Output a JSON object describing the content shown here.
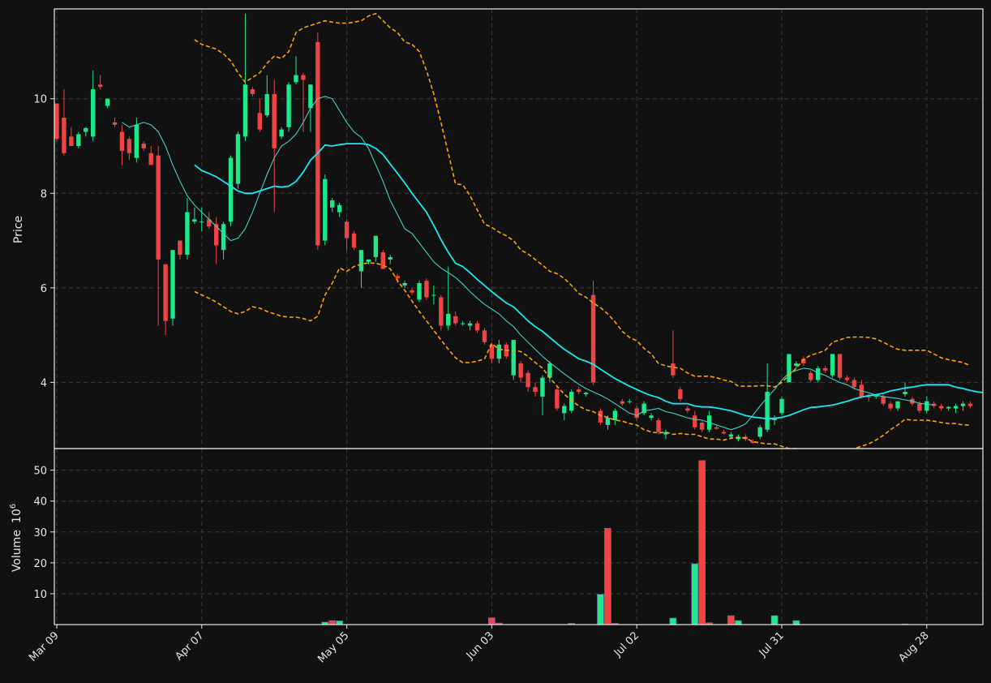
{
  "chart_data": {
    "type": "candlestick",
    "colors": {
      "up": "#1de98b",
      "down": "#ef4444",
      "ma_slow": "#19e8f4",
      "ma_fast": "#3fd3c6",
      "bands": "#ffa500",
      "background": "#111111",
      "grid": "#3c3c3c",
      "text": "#e6e6e6"
    },
    "price_panel": {
      "ylabel": "Price",
      "yticks": [
        4,
        6,
        8,
        10
      ],
      "ylim": [
        2.6,
        11.9
      ],
      "grid": true
    },
    "volume_panel": {
      "ylabel": "Volume",
      "scale_label": "10",
      "scale_exp": "6",
      "yticks": [
        10,
        20,
        30,
        40,
        50
      ],
      "ylim": [
        0,
        57
      ],
      "grid": true
    },
    "x_tick_labels": [
      "Mar 09",
      "Apr 07",
      "May 05",
      "Jun 03",
      "Jul 02",
      "Jul 31",
      "Aug 28"
    ],
    "x_tick_index": [
      0,
      20,
      40,
      60,
      80,
      100,
      120
    ],
    "candles": [
      [
        9.9,
        9.9,
        9.1,
        9.15
      ],
      [
        9.6,
        10.2,
        8.8,
        8.85
      ],
      [
        9.2,
        9.4,
        9.0,
        9.0
      ],
      [
        9.0,
        9.3,
        8.95,
        9.25
      ],
      [
        9.3,
        9.4,
        9.2,
        9.38
      ],
      [
        9.2,
        10.6,
        9.1,
        10.2
      ],
      [
        10.3,
        10.5,
        10.2,
        10.25
      ],
      [
        9.85,
        10.0,
        9.8,
        10.0
      ],
      [
        9.5,
        9.6,
        9.4,
        9.45
      ],
      [
        9.3,
        9.45,
        8.6,
        8.9
      ],
      [
        9.15,
        9.2,
        8.7,
        8.85
      ],
      [
        8.75,
        9.6,
        8.65,
        9.45
      ],
      [
        9.05,
        9.1,
        8.9,
        8.95
      ],
      [
        8.85,
        9.0,
        8.6,
        8.6
      ],
      [
        8.8,
        9.0,
        5.2,
        6.6
      ],
      [
        6.5,
        6.5,
        5.0,
        5.3
      ],
      [
        5.35,
        6.8,
        5.2,
        6.8
      ],
      [
        7.0,
        7.0,
        6.6,
        6.7
      ],
      [
        6.7,
        7.9,
        6.6,
        7.6
      ],
      [
        7.4,
        7.7,
        7.35,
        7.45
      ],
      [
        7.4,
        7.7,
        7.2,
        7.4
      ],
      [
        7.45,
        7.6,
        7.25,
        7.3
      ],
      [
        7.35,
        7.5,
        6.5,
        6.9
      ],
      [
        6.8,
        7.4,
        6.6,
        7.35
      ],
      [
        7.4,
        8.8,
        7.3,
        8.75
      ],
      [
        8.2,
        9.3,
        8.1,
        9.25
      ],
      [
        9.2,
        11.8,
        9.1,
        10.3
      ],
      [
        10.2,
        10.25,
        10.05,
        10.1
      ],
      [
        9.7,
        10.0,
        9.3,
        9.35
      ],
      [
        9.65,
        10.5,
        9.6,
        10.1
      ],
      [
        10.1,
        10.4,
        7.6,
        8.95
      ],
      [
        9.2,
        9.4,
        9.15,
        9.35
      ],
      [
        9.4,
        10.35,
        9.3,
        10.3
      ],
      [
        10.35,
        10.9,
        10.3,
        10.5
      ],
      [
        10.5,
        10.55,
        9.3,
        10.4
      ],
      [
        9.8,
        10.3,
        9.3,
        10.3
      ],
      [
        11.2,
        11.4,
        6.8,
        6.9
      ],
      [
        7.0,
        8.4,
        6.9,
        8.3
      ],
      [
        7.7,
        7.9,
        7.6,
        7.85
      ],
      [
        7.6,
        7.8,
        7.5,
        7.75
      ],
      [
        7.4,
        7.45,
        6.8,
        7.05
      ],
      [
        7.15,
        7.2,
        6.8,
        6.85
      ],
      [
        6.35,
        6.8,
        6.0,
        6.8
      ],
      [
        6.55,
        6.6,
        6.5,
        6.6
      ],
      [
        6.65,
        7.1,
        6.55,
        7.1
      ],
      [
        6.75,
        6.8,
        6.4,
        6.4
      ],
      [
        6.6,
        6.7,
        6.5,
        6.65
      ],
      [
        6.25,
        6.3,
        6.1,
        6.2
      ],
      [
        6.05,
        6.15,
        6.0,
        6.1
      ],
      [
        5.95,
        6.0,
        5.85,
        5.9
      ],
      [
        5.75,
        6.15,
        5.7,
        6.1
      ],
      [
        6.15,
        6.2,
        5.75,
        5.8
      ],
      [
        5.85,
        6.05,
        5.65,
        5.85
      ],
      [
        5.8,
        5.85,
        5.1,
        5.2
      ],
      [
        5.2,
        6.45,
        5.1,
        5.45
      ],
      [
        5.4,
        5.5,
        5.2,
        5.25
      ],
      [
        5.25,
        5.3,
        5.2,
        5.25
      ],
      [
        5.2,
        5.3,
        5.1,
        5.25
      ],
      [
        5.25,
        5.3,
        5.05,
        5.1
      ],
      [
        5.1,
        5.15,
        4.8,
        4.85
      ],
      [
        4.8,
        4.8,
        4.4,
        4.5
      ],
      [
        4.5,
        4.9,
        4.4,
        4.8
      ],
      [
        4.8,
        4.85,
        4.5,
        4.55
      ],
      [
        4.15,
        4.9,
        4.05,
        4.9
      ],
      [
        4.4,
        4.45,
        4.0,
        4.1
      ],
      [
        4.2,
        4.25,
        3.8,
        3.9
      ],
      [
        3.9,
        4.0,
        3.7,
        3.8
      ],
      [
        3.7,
        4.15,
        3.3,
        4.1
      ],
      [
        4.1,
        4.45,
        4.0,
        4.4
      ],
      [
        3.85,
        3.9,
        3.4,
        3.45
      ],
      [
        3.35,
        3.55,
        3.2,
        3.5
      ],
      [
        3.4,
        3.85,
        3.35,
        3.8
      ],
      [
        3.85,
        3.9,
        3.75,
        3.8
      ],
      [
        3.75,
        3.8,
        3.7,
        3.78
      ],
      [
        5.85,
        6.15,
        3.95,
        4.0
      ],
      [
        3.4,
        3.45,
        3.1,
        3.15
      ],
      [
        3.1,
        3.3,
        3.0,
        3.25
      ],
      [
        3.2,
        3.45,
        3.1,
        3.4
      ],
      [
        3.6,
        3.65,
        3.5,
        3.55
      ],
      [
        3.6,
        3.65,
        3.55,
        3.6
      ],
      [
        3.45,
        3.5,
        3.2,
        3.25
      ],
      [
        3.35,
        3.6,
        3.3,
        3.55
      ],
      [
        3.25,
        3.35,
        3.2,
        3.3
      ],
      [
        3.2,
        3.25,
        2.9,
        2.95
      ],
      [
        2.9,
        3.0,
        2.8,
        2.95
      ],
      [
        4.4,
        5.1,
        4.1,
        4.15
      ],
      [
        3.85,
        3.9,
        3.6,
        3.65
      ],
      [
        3.45,
        3.5,
        3.35,
        3.4
      ],
      [
        3.3,
        3.4,
        3.0,
        3.05
      ],
      [
        3.15,
        3.2,
        2.95,
        3.0
      ],
      [
        3.0,
        3.4,
        2.95,
        3.3
      ],
      [
        3.05,
        3.1,
        3.0,
        3.02
      ],
      [
        2.95,
        3.0,
        2.9,
        2.92
      ],
      [
        2.85,
        2.95,
        2.8,
        2.9
      ],
      [
        2.8,
        2.9,
        2.75,
        2.85
      ],
      [
        2.85,
        2.9,
        2.75,
        2.8
      ],
      [
        2.75,
        2.8,
        2.7,
        2.72
      ],
      [
        2.85,
        3.1,
        2.8,
        3.05
      ],
      [
        3.0,
        4.4,
        2.95,
        3.8
      ],
      [
        3.2,
        3.3,
        3.1,
        3.25
      ],
      [
        3.35,
        3.7,
        3.3,
        3.65
      ],
      [
        4.0,
        4.6,
        4.0,
        4.6
      ],
      [
        4.35,
        4.45,
        4.3,
        4.4
      ],
      [
        4.5,
        4.55,
        4.35,
        4.4
      ],
      [
        4.2,
        4.25,
        4.0,
        4.05
      ],
      [
        4.05,
        4.35,
        4.0,
        4.3
      ],
      [
        4.3,
        4.35,
        4.2,
        4.25
      ],
      [
        4.15,
        4.6,
        4.1,
        4.6
      ],
      [
        4.6,
        4.6,
        4.05,
        4.1
      ],
      [
        4.1,
        4.15,
        4.0,
        4.05
      ],
      [
        4.05,
        4.1,
        3.85,
        3.9
      ],
      [
        3.95,
        4.05,
        3.65,
        3.7
      ],
      [
        3.7,
        3.75,
        3.6,
        3.68
      ],
      [
        3.7,
        3.75,
        3.65,
        3.72
      ],
      [
        3.7,
        3.75,
        3.5,
        3.55
      ],
      [
        3.55,
        3.6,
        3.4,
        3.45
      ],
      [
        3.45,
        3.6,
        3.4,
        3.6
      ],
      [
        3.75,
        4.0,
        3.7,
        3.8
      ],
      [
        3.65,
        3.7,
        3.5,
        3.55
      ],
      [
        3.55,
        3.6,
        3.35,
        3.4
      ],
      [
        3.4,
        3.7,
        3.35,
        3.6
      ],
      [
        3.55,
        3.6,
        3.45,
        3.5
      ],
      [
        3.5,
        3.55,
        3.4,
        3.45
      ],
      [
        3.45,
        3.5,
        3.4,
        3.48
      ],
      [
        3.45,
        3.55,
        3.35,
        3.5
      ],
      [
        3.5,
        3.6,
        3.4,
        3.55
      ],
      [
        3.55,
        3.6,
        3.45,
        3.5
      ]
    ],
    "ma_slow": {
      "start": 19,
      "values": [
        8.6,
        8.48,
        8.42,
        8.35,
        8.25,
        8.15,
        8.05,
        8.0,
        8.0,
        8.05,
        8.1,
        8.15,
        8.13,
        8.15,
        8.25,
        8.45,
        8.7,
        8.85,
        9.02,
        9.0,
        9.03,
        9.05,
        9.05,
        9.05,
        9.03,
        8.95,
        8.82,
        8.62,
        8.42,
        8.22,
        8.0,
        7.8,
        7.6,
        7.32,
        7.02,
        6.75,
        6.52,
        6.45,
        6.32,
        6.18,
        6.05,
        5.92,
        5.8,
        5.68,
        5.6,
        5.45,
        5.3,
        5.18,
        5.08,
        4.95,
        4.82,
        4.7,
        4.6,
        4.5,
        4.45,
        4.38,
        4.28,
        4.18,
        4.08,
        4.0,
        3.92,
        3.85,
        3.78,
        3.72,
        3.68,
        3.6,
        3.55,
        3.55,
        3.55,
        3.5,
        3.48,
        3.48,
        3.46,
        3.43,
        3.4,
        3.35,
        3.3,
        3.27,
        3.25,
        3.23,
        3.24,
        3.26,
        3.3,
        3.36,
        3.42,
        3.47,
        3.48,
        3.5,
        3.52,
        3.56,
        3.6,
        3.65,
        3.69,
        3.72,
        3.74,
        3.77,
        3.82,
        3.85,
        3.88,
        3.9,
        3.93,
        3.95,
        3.95,
        3.95,
        3.95,
        3.9,
        3.87,
        3.83,
        3.8,
        3.78,
        3.75
      ]
    },
    "ma_fast": {
      "start": 9,
      "values": [
        9.5,
        9.4,
        9.45,
        9.5,
        9.45,
        9.3,
        9.0,
        8.6,
        8.25,
        7.95,
        7.75,
        7.6,
        7.45,
        7.3,
        7.15,
        7.0,
        7.05,
        7.25,
        7.6,
        8.0,
        8.4,
        8.75,
        9.0,
        9.1,
        9.25,
        9.5,
        9.8,
        10.0,
        10.05,
        10.0,
        9.75,
        9.5,
        9.3,
        9.18,
        8.95,
        8.6,
        8.25,
        7.85,
        7.55,
        7.25,
        7.15,
        6.95,
        6.75,
        6.55,
        6.42,
        6.32,
        6.22,
        6.08,
        5.92,
        5.78,
        5.65,
        5.55,
        5.45,
        5.3,
        5.18,
        5.0,
        4.85,
        4.7,
        4.55,
        4.42,
        4.3,
        4.18,
        4.07,
        3.96,
        3.87,
        3.8,
        3.73,
        3.65,
        3.55,
        3.45,
        3.35,
        3.3,
        3.4,
        3.42,
        3.45,
        3.38,
        3.35,
        3.3,
        3.25,
        3.22,
        3.2,
        3.15,
        3.1,
        3.05,
        3.0,
        3.05,
        3.12,
        3.3,
        3.5,
        3.68,
        3.85,
        4.05,
        4.2,
        4.25,
        4.3,
        4.28,
        4.2,
        4.15,
        4.07,
        4.0,
        3.95,
        3.87,
        3.82,
        3.78,
        3.73,
        3.7,
        3.68,
        3.66,
        3.63,
        3.6,
        3.56,
        3.54,
        3.52
      ]
    },
    "band_upper": {
      "start": 19,
      "values": [
        11.25,
        11.15,
        11.1,
        11.05,
        10.95,
        10.8,
        10.55,
        10.35,
        10.45,
        10.55,
        10.75,
        10.9,
        10.85,
        11.0,
        11.4,
        11.5,
        11.55,
        11.6,
        11.65,
        11.62,
        11.6,
        11.6,
        11.62,
        11.65,
        11.75,
        11.8,
        11.65,
        11.5,
        11.4,
        11.2,
        11.15,
        11.0,
        10.6,
        10.1,
        9.5,
        8.85,
        8.2,
        8.18,
        7.95,
        7.65,
        7.35,
        7.28,
        7.18,
        7.1,
        7.0,
        6.8,
        6.72,
        6.6,
        6.48,
        6.35,
        6.3,
        6.2,
        6.05,
        5.88,
        5.8,
        5.68,
        5.58,
        5.45,
        5.28,
        5.08,
        4.95,
        4.88,
        4.72,
        4.6,
        4.4,
        4.35,
        4.32,
        4.3,
        4.2,
        4.13,
        4.13,
        4.13,
        4.1,
        4.05,
        4.02,
        3.92,
        3.92,
        3.92,
        3.93,
        3.93,
        3.9,
        4.0,
        4.15,
        4.3,
        4.48,
        4.58,
        4.62,
        4.68,
        4.85,
        4.9,
        4.95,
        4.96,
        4.96,
        4.95,
        4.92,
        4.85,
        4.77,
        4.7,
        4.68,
        4.68,
        4.68,
        4.68,
        4.6,
        4.52,
        4.48,
        4.45,
        4.42,
        4.35
      ]
    },
    "band_lower": {
      "start": 19,
      "values": [
        5.92,
        5.85,
        5.78,
        5.7,
        5.6,
        5.5,
        5.45,
        5.5,
        5.6,
        5.57,
        5.5,
        5.45,
        5.4,
        5.38,
        5.38,
        5.35,
        5.3,
        5.4,
        5.85,
        6.1,
        6.42,
        6.35,
        6.45,
        6.5,
        6.53,
        6.52,
        6.48,
        6.4,
        6.15,
        5.95,
        5.72,
        5.5,
        5.3,
        5.1,
        4.9,
        4.7,
        4.52,
        4.42,
        4.42,
        4.45,
        4.5,
        4.82,
        4.7,
        4.68,
        4.68,
        4.65,
        4.55,
        4.42,
        4.3,
        4.1,
        3.92,
        3.75,
        3.62,
        3.5,
        3.42,
        3.38,
        3.3,
        3.26,
        3.2,
        3.18,
        3.13,
        3.1,
        3.0,
        2.95,
        2.93,
        2.95,
        2.9,
        2.92,
        2.9,
        2.9,
        2.85,
        2.8,
        2.8,
        2.78,
        2.82,
        2.84,
        2.82,
        2.75,
        2.72,
        2.7,
        2.7,
        2.65,
        2.6,
        2.6,
        2.59,
        2.56,
        2.55,
        2.54,
        2.55,
        2.56,
        2.58,
        2.6,
        2.65,
        2.7,
        2.78,
        2.88,
        3.0,
        3.1,
        3.22,
        3.2,
        3.2,
        3.2,
        3.18,
        3.15,
        3.13,
        3.13,
        3.1,
        3.1
      ]
    },
    "volume_bars": [
      {
        "i": 37,
        "v": 0.8,
        "dir": "up"
      },
      {
        "i": 38,
        "v": 1.3,
        "dir": "down"
      },
      {
        "i": 39,
        "v": 1.2,
        "dir": "up"
      },
      {
        "i": 60,
        "v": 2.2,
        "dir": "down"
      },
      {
        "i": 61,
        "v": 0.5,
        "dir": "down"
      },
      {
        "i": 71,
        "v": 0.4,
        "dir": "down"
      },
      {
        "i": 75,
        "v": 9.8,
        "dir": "up"
      },
      {
        "i": 76,
        "v": 31.2,
        "dir": "down"
      },
      {
        "i": 77,
        "v": 0.4,
        "dir": "down"
      },
      {
        "i": 85,
        "v": 2.1,
        "dir": "up"
      },
      {
        "i": 88,
        "v": 19.7,
        "dir": "up"
      },
      {
        "i": 89,
        "v": 53.1,
        "dir": "down"
      },
      {
        "i": 90,
        "v": 0.6,
        "dir": "down"
      },
      {
        "i": 93,
        "v": 2.9,
        "dir": "down"
      },
      {
        "i": 94,
        "v": 1.3,
        "dir": "up"
      },
      {
        "i": 99,
        "v": 2.9,
        "dir": "up"
      },
      {
        "i": 102,
        "v": 1.3,
        "dir": "up"
      },
      {
        "i": 117,
        "v": 0.2,
        "dir": "up"
      }
    ]
  }
}
